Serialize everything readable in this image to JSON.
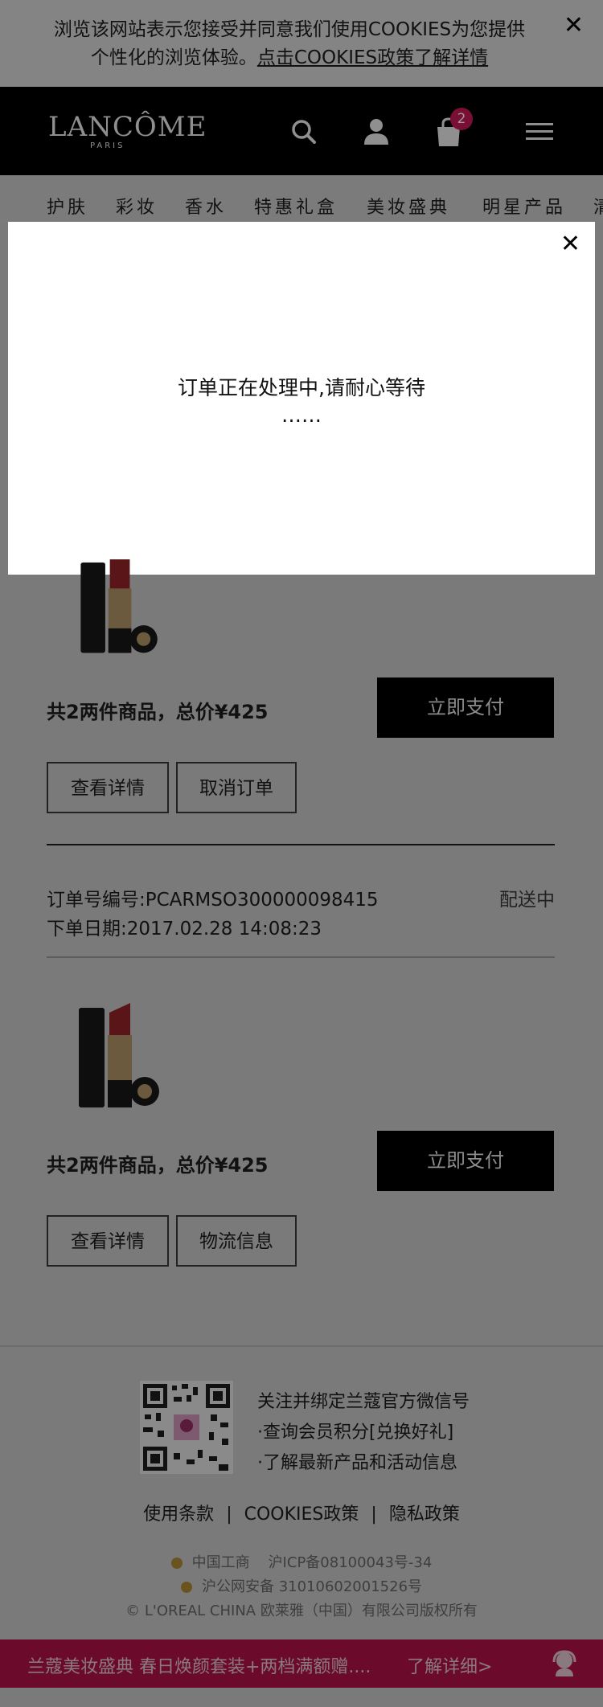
{
  "cookie": {
    "line1": "浏览该网站表示您接受并同意我们使用COOKIES为您提供",
    "line2_prefix": "个性化的浏览体验。",
    "line2_link": "点击COOKIES政策了解详情",
    "close": "✕"
  },
  "header": {
    "logo": "LANCÔME",
    "logo_sub": "PARIS",
    "cart_count": "2"
  },
  "nav": {
    "items": [
      "护肤",
      "彩妆",
      "香水",
      "特惠礼盒",
      "美妆盛典",
      "明星产品",
      "清"
    ]
  },
  "modal": {
    "close": "✕",
    "message_line1": "订单正在处理中,请耐心等待",
    "message_line2": "……"
  },
  "orders": [
    {
      "total": "共2两件商品，总价¥425",
      "pay": "立即支付",
      "detail_btn": "查看详情",
      "action_btn": "取消订单"
    },
    {
      "order_no": "订单号编号:PCARMSO300000098415",
      "order_date": "下单日期:2017.02.28 14:08:23",
      "status": "配送中",
      "total": "共2两件商品，总价¥425",
      "pay": "立即支付",
      "detail_btn": "查看详情",
      "action_btn": "物流信息"
    }
  ],
  "footer": {
    "wx_title": "关注并绑定兰蔻官方微信号",
    "wx_point1": "·查询会员积分[兑换好礼]",
    "wx_point2": "·了解最新产品和活动信息",
    "links": [
      "使用条款",
      "COOKIES政策",
      "隐私政策"
    ],
    "sep": "|",
    "icp1_label": "中国工商",
    "icp1": "沪ICP备08100043号-34",
    "icp2": "沪公网安备 31010602001526号",
    "copyright": "© L'OREAL CHINA 欧莱雅（中国）有限公司版权所有"
  },
  "promo": {
    "text": "兰蔻美妆盛典 春日焕颜套装+两档满额赠....",
    "link": "了解详细>"
  },
  "colors": {
    "promo_bg": "#6b0a2b",
    "badge": "#7a0f36",
    "overlay": "#7a7a7a"
  }
}
